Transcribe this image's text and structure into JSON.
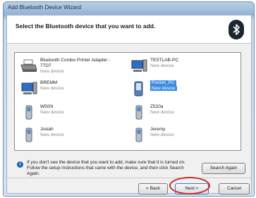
{
  "window": {
    "title": "Add Bluetooth Device Wizard"
  },
  "header": {
    "heading": "Select the Bluetooth device that you want to add."
  },
  "devices": [
    {
      "name": "Bluetooth Combo Printer Adapter - 77D7",
      "status": "New device",
      "icon": "printer-icon"
    },
    {
      "name": "TESTLAB-PC",
      "status": "New device",
      "icon": "computer-icon"
    },
    {
      "name": "BREMM",
      "status": "New device",
      "icon": "computer-icon"
    },
    {
      "name": "Pocket_PC",
      "status": "New device",
      "icon": "pda-icon",
      "selected": true
    },
    {
      "name": "W500i",
      "status": "New device",
      "icon": "phone-icon"
    },
    {
      "name": "Z520a",
      "status": "New device",
      "icon": "phone-icon"
    },
    {
      "name": "Josiah",
      "status": "New device",
      "icon": "phone-icon"
    },
    {
      "name": "Jeremy",
      "status": "New device",
      "icon": "phone-icon"
    }
  ],
  "info": {
    "text": "If you don't see the device that you want to add, make sure that it is turned on. Follow the setup instructions that came with the device, and then click Search Again."
  },
  "buttons": {
    "search_again": "Search Again",
    "back": "< Back",
    "next": "Next >",
    "cancel": "Cancel"
  },
  "colors": {
    "selection": "#3c8be0",
    "highlight_circle": "#c92a2a"
  }
}
